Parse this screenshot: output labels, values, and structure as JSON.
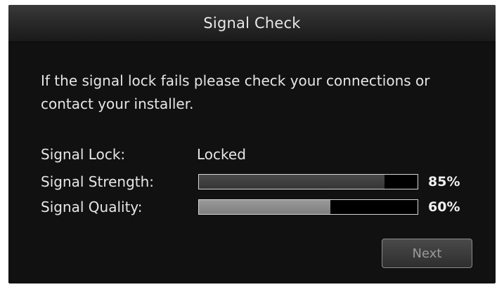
{
  "dialog": {
    "title": "Signal Check",
    "message": "If the signal lock fails please check your connections or contact your installer.",
    "rows": {
      "lock": {
        "label": "Signal Lock:",
        "value": "Locked"
      },
      "strength": {
        "label": "Signal Strength:",
        "percent_text": "85%",
        "level": 0.85
      },
      "quality": {
        "label": "Signal Quality:",
        "percent_text": "60%",
        "level": 0.6
      }
    },
    "next_label": "Next"
  },
  "colors": {
    "dialog_background": "#111111",
    "text": "#e6e6e6",
    "bar_border": "#d6d6d6",
    "strength_fill": "#404040",
    "quality_fill": "#8c8c8c",
    "button_text_disabled": "#9a9a9a"
  }
}
